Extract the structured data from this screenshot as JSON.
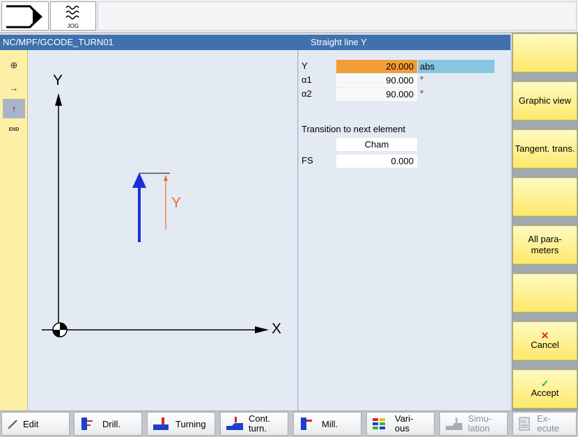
{
  "header": {
    "jog_label": "JOG"
  },
  "titlebar": {
    "path": "NC/MPF/GCODE_TURN01",
    "form_title": "Straight line Y"
  },
  "left_strip": {
    "items": [
      {
        "icon": "crosshair-icon",
        "glyph": "⊕"
      },
      {
        "icon": "arrow-right-icon",
        "glyph": "→"
      },
      {
        "icon": "arrow-up-icon",
        "glyph": "↑"
      },
      {
        "icon": "end-icon",
        "label": "END"
      }
    ]
  },
  "graphic": {
    "axis_y": "Y",
    "axis_x": "X",
    "dim_label": "Y"
  },
  "params": {
    "y": {
      "label": "Y",
      "value": "20.000",
      "unit": "abs"
    },
    "a1": {
      "label": "α1",
      "value": "90.000",
      "unit": "°"
    },
    "a2": {
      "label": "α2",
      "value": "90.000",
      "unit": "°"
    },
    "transition_label": "Transition to next element",
    "transition_value": "Cham",
    "fs": {
      "label": "FS",
      "value": "0.000"
    }
  },
  "softkeys_right": {
    "graphic_view": "Graphic view",
    "tangent_trans": "Tangent. trans.",
    "all_params": "All para- meters",
    "cancel": "Cancel",
    "accept": "Accept"
  },
  "softkeys_bottom": {
    "edit": "Edit",
    "drill": "Drill.",
    "turning": "Turning",
    "cont_turn_1": "Cont.",
    "cont_turn_2": "turn.",
    "mill": "Mill.",
    "various_1": "Vari-",
    "various_2": "ous",
    "simulation_1": "Simu-",
    "simulation_2": "lation",
    "execute_1": "Ex-",
    "execute_2": "ecute"
  },
  "colors": {
    "title_blue": "#3e71ad",
    "active_field": "#f29c38",
    "unit_field": "#87c6df",
    "softkey_yellow": "#fde96a",
    "arrow_blue": "#1a2fd6",
    "dim_orange": "#e8702e"
  }
}
